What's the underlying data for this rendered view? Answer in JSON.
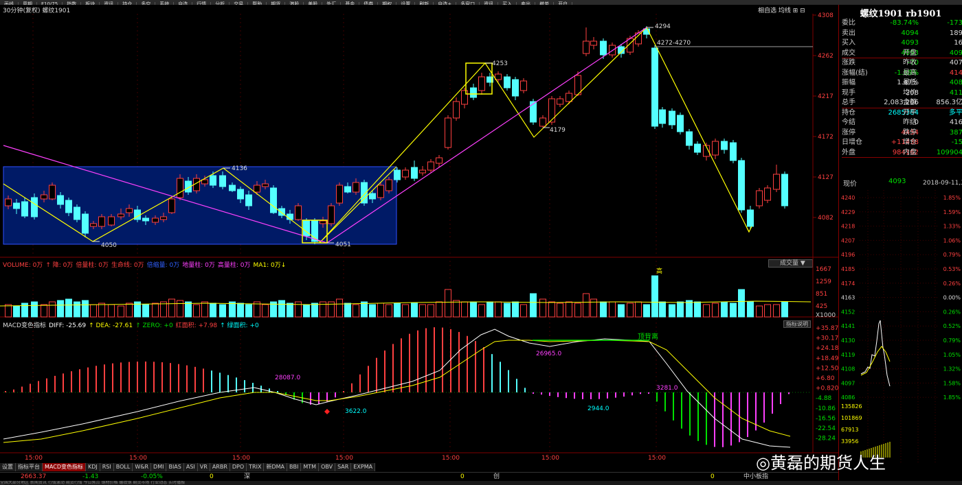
{
  "top_menu": [
    "画线",
    "周期",
    "F10/75",
    "指数",
    "板块",
    "资讯",
    "持仓",
    "多空",
    "系统",
    "自选",
    "行情",
    "分析",
    "交易",
    "帮助",
    "期货",
    "港股",
    "美股",
    "外汇",
    "基金",
    "债券",
    "期权",
    "设置",
    "刷新",
    "自选+",
    "多窗口",
    "资讯",
    "买入",
    "卖出",
    "撤单",
    "开户"
  ],
  "chart": {
    "title": "30分钟(复权)  螺纹1901",
    "tools": "相自选 均线 ⊞ ⊟",
    "price_axis": [
      "4308",
      "4262",
      "4217",
      "4172",
      "4127",
      "4082"
    ],
    "annotations": {
      "p4050": "4050",
      "p4136": "4136",
      "p4051": "4051",
      "p4253": "4253",
      "p4179": "4179",
      "p4294": "4294",
      "range": "4272-4270"
    }
  },
  "volume": {
    "legend": [
      {
        "t": "VOLUME: 0万",
        "c": "#ff4040"
      },
      {
        "t": "↑ 降: 0万",
        "c": "#ff4040"
      },
      {
        "t": "倍量柱: 0万",
        "c": "#ff4040"
      },
      {
        "t": "生命线: 0万",
        "c": "#ff4040"
      },
      {
        "t": "倍缩量: 0万",
        "c": "#3060ff"
      },
      {
        "t": "地量柱: 0万",
        "c": "#ff40ff"
      },
      {
        "t": "高量柱: 0万",
        "c": "#ff40ff"
      },
      {
        "t": "MA1: 0万↓",
        "c": "#ffff00"
      }
    ],
    "dropdown": "成交量",
    "axis": [
      "1667",
      "1259",
      "851",
      "425",
      "X1000"
    ],
    "label_high": "高"
  },
  "macd": {
    "legend": [
      {
        "t": "MACD变色指标",
        "c": "#ddd"
      },
      {
        "t": "DIFF: -25.69",
        "c": "#ffffff"
      },
      {
        "t": "↑ DEA: -27.61",
        "c": "#ffff00"
      },
      {
        "t": "↑ ZERO: +0",
        "c": "#00e000"
      },
      {
        "t": "红面积: +7.98",
        "c": "#ff4040"
      },
      {
        "t": "↑ 绿面积: +0",
        "c": "#00ffff"
      }
    ],
    "help": "指标说明",
    "axis": [
      "+35.87",
      "+30.17",
      "+24.18",
      "+18.49",
      "+12.50",
      "+6.80",
      "+0.820",
      "-4.88",
      "-10.86",
      "-16.56",
      "-22.54",
      "-28.24"
    ],
    "labels": {
      "v28087": "28087.0",
      "v3622": "3622.0",
      "v26965": "26965.0",
      "v2944": "2944.0",
      "v3281": "3281.0",
      "dingbeili": "顶背离"
    }
  },
  "time_axis": [
    "15:00",
    "15:00",
    "15:00",
    "15:00",
    "15:00",
    "15:00",
    "15:00"
  ],
  "bottom_tabs": [
    {
      "label": "设置",
      "active": false
    },
    {
      "label": "指标平台",
      "active": false
    },
    {
      "label": "MACD变色指标",
      "active": true
    },
    {
      "label": "KDJ",
      "active": false
    },
    {
      "label": "RSI",
      "active": false
    },
    {
      "label": "BOLL",
      "active": false
    },
    {
      "label": "W&R",
      "active": false
    },
    {
      "label": "DMI",
      "active": false
    },
    {
      "label": "BIAS",
      "active": false
    },
    {
      "label": "ASI",
      "active": false
    },
    {
      "label": "VR",
      "active": false
    },
    {
      "label": "ARBR",
      "active": false
    },
    {
      "label": "DPO",
      "active": false
    },
    {
      "label": "TRIX",
      "active": false
    },
    {
      "label": "新DMA",
      "active": false
    },
    {
      "label": "BBI",
      "active": false
    },
    {
      "label": "MTM",
      "active": false
    },
    {
      "label": "OBV",
      "active": false
    },
    {
      "label": "SAR",
      "active": false
    },
    {
      "label": "EXPMA",
      "active": false
    }
  ],
  "status": {
    "v1": "2663.37",
    "v2": "-1.43",
    "v3": "-0.05%",
    "v4": "0",
    "sh": "深",
    "z": "0",
    "chuang": "创",
    "zs": "0",
    "zx": "中小板指",
    "zx2": "0"
  },
  "news": "全国大部分地区 新闻资讯 行情滚动 期货行情 今日焦点 钢材价格 螺纹钢 期货市场 行业动态 实时播报",
  "quote": {
    "title": "螺纹1901 rb1901",
    "rows": [
      {
        "l": "委比",
        "v1": "-83.74%",
        "c1": "grn",
        "l2": "",
        "v2": "-173",
        "c2": "grn"
      },
      {
        "l": "卖出",
        "v1": "4094",
        "c1": "grn",
        "l2": "",
        "v2": "189",
        "c2": "wht"
      },
      {
        "l": "买入",
        "v1": "4093",
        "c1": "grn",
        "l2": "",
        "v2": "16",
        "c2": "wht"
      },
      {
        "l": "成交",
        "v1": "4093",
        "c1": "grn",
        "l2": "开盘",
        "v2": "409",
        "c2": "grn"
      },
      {
        "l": "涨跌",
        "v1": "-70",
        "c1": "grn",
        "l2": "昨收",
        "v2": "407",
        "c2": "wht"
      },
      {
        "l": "涨幅(结)",
        "v1": "-1.68%",
        "c1": "grn",
        "l2": "最高",
        "v2": "414",
        "c2": "red"
      },
      {
        "l": "振幅",
        "v1": "1.47%",
        "c1": "wht",
        "l2": "最低",
        "v2": "408",
        "c2": "grn"
      },
      {
        "l": "现手",
        "v1": "208",
        "c1": "wht",
        "l2": "均价",
        "v2": "411",
        "c2": "grn"
      },
      {
        "l": "总手",
        "v1": "2,083,206",
        "c1": "wht",
        "l2": "金额",
        "v2": "856.3亿",
        "c2": "wht"
      },
      {
        "l": "持仓",
        "v1": "2685384",
        "c1": "cyn",
        "l2": "开平",
        "v2": "多平",
        "c2": "cyn"
      },
      {
        "l": "今结",
        "v1": "0",
        "c1": "wht",
        "l2": "昨结",
        "v2": "416",
        "c2": "wht"
      },
      {
        "l": "涨停",
        "v1": "4454",
        "c1": "red",
        "l2": "跌停",
        "v2": "387",
        "c2": "grn"
      },
      {
        "l": "日增仓",
        "v1": "+11438",
        "c1": "red",
        "l2": "增仓",
        "v2": "-15",
        "c2": "grn"
      },
      {
        "l": "外盘",
        "v1": "984162",
        "c1": "red",
        "l2": "内盘",
        "v2": "109904",
        "c2": "grn"
      }
    ],
    "now_label": "现价",
    "now_value": "4093",
    "date": "2018-09-11,二",
    "mini_left": [
      "4240",
      "4229",
      "4218",
      "4207",
      "4196",
      "4185",
      "4174",
      "4163",
      "4152",
      "4141",
      "4130",
      "4119",
      "4108",
      "4097",
      "4086"
    ],
    "mini_right": [
      "1.85%",
      "1.59%",
      "1.33%",
      "1.06%",
      "0.79%",
      "0.53%",
      "0.26%",
      "0.00%",
      "0.26%",
      "0.52%",
      "0.79%",
      "1.05%",
      "1.32%",
      "1.58%",
      "1.85%"
    ],
    "mini_vol": [
      "135826",
      "101869",
      "67913",
      "33956"
    ]
  },
  "watermark": "黄磊的期货人生"
}
